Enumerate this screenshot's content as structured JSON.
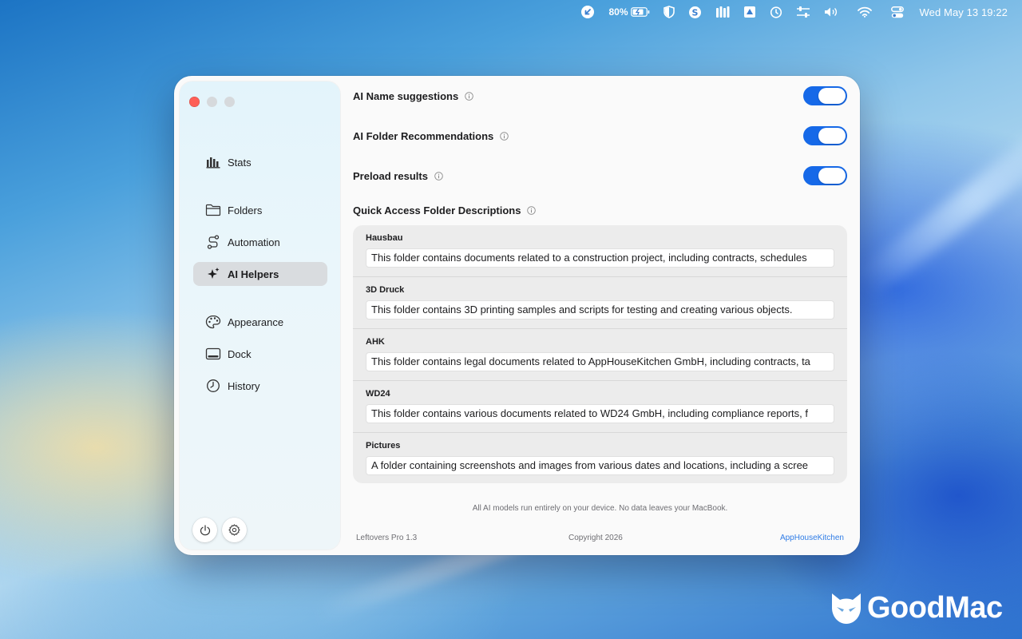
{
  "menubar": {
    "battery_percent": "80%",
    "clock": "Wed May 13  19:22",
    "icons": [
      "arrow-circle-icon",
      "battery-icon",
      "shield-icon",
      "dollar-circle-icon",
      "bars-icon",
      "drive-icon",
      "timer-icon",
      "sliders-icon",
      "volume-icon",
      "wifi-icon",
      "control-center-icon"
    ]
  },
  "sidebar": {
    "items": [
      {
        "label": "Stats",
        "icon": "chart-icon"
      },
      {
        "label": "Folders",
        "icon": "folder-icon"
      },
      {
        "label": "Automation",
        "icon": "path-icon"
      },
      {
        "label": "AI Helpers",
        "icon": "sparkles-icon",
        "active": true
      },
      {
        "label": "Appearance",
        "icon": "palette-icon"
      },
      {
        "label": "Dock",
        "icon": "dock-icon"
      },
      {
        "label": "History",
        "icon": "clock-icon"
      }
    ]
  },
  "settings": {
    "ai_name_suggestions": {
      "label": "AI Name suggestions",
      "enabled": true
    },
    "ai_folder_recommendations": {
      "label": "AI Folder Recommendations",
      "enabled": true
    },
    "preload_results": {
      "label": "Preload results",
      "enabled": true
    }
  },
  "quick_access": {
    "title": "Quick Access Folder Descriptions",
    "folders": [
      {
        "name": "Hausbau",
        "description": "This folder contains documents related to a construction project, including contracts, schedules"
      },
      {
        "name": "3D Druck",
        "description": "This folder contains 3D printing samples and scripts for testing and creating various objects."
      },
      {
        "name": "AHK",
        "description": "This folder contains legal documents related to AppHouseKitchen GmbH, including contracts, ta"
      },
      {
        "name": "WD24",
        "description": "This folder contains various documents related to WD24 GmbH, including compliance reports, f"
      },
      {
        "name": "Pictures",
        "description": "A folder containing screenshots and images from various dates and locations, including a scree"
      }
    ]
  },
  "privacy_note": "All AI models run entirely on your device. No data leaves your MacBook.",
  "footer": {
    "version": "Leftovers Pro 1.3",
    "copyright": "Copyright 2026",
    "link": "AppHouseKitchen"
  },
  "watermark": {
    "text": "GoodMac"
  },
  "colors": {
    "accent": "#1669e8",
    "link": "#2f7ce6",
    "close": "#fe5f57"
  }
}
